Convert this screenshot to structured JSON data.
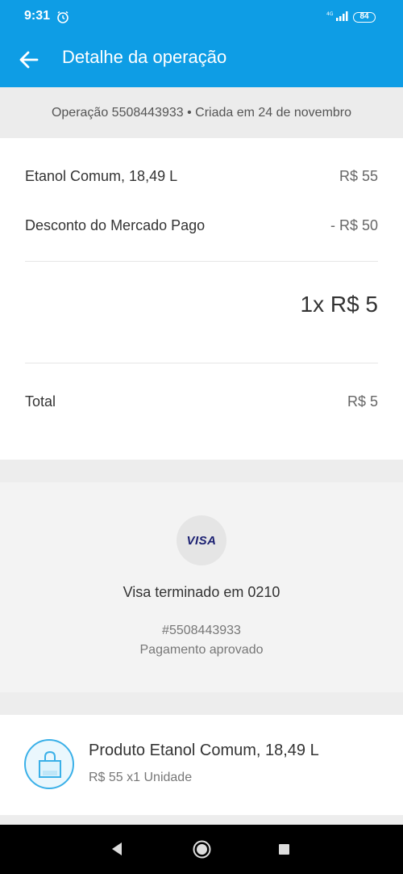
{
  "status_bar": {
    "time": "9:31",
    "network": "4G",
    "battery": "84"
  },
  "header": {
    "title": "Detalhe da operação"
  },
  "operation_banner": "Operação 5508443933 • Criada em 24 de novembro",
  "items": [
    {
      "label": "Etanol Comum, 18,49 L",
      "amount": "R$ 55"
    },
    {
      "label": "Desconto do Mercado Pago",
      "amount": "- R$ 50"
    }
  ],
  "installments": "1x R$ 5",
  "total": {
    "label": "Total",
    "amount": "R$ 5"
  },
  "payment": {
    "card_brand": "VISA",
    "card_name": "Visa terminado em 0210",
    "operation_number": "#5508443933",
    "status": "Pagamento aprovado"
  },
  "product": {
    "title": "Produto Etanol Comum, 18,49 L",
    "subtitle": "R$ 55 x1 Unidade"
  },
  "colors": {
    "primary": "#0e9de5",
    "visa": "#1a1f71",
    "icon_accent": "#3ab0e8"
  }
}
